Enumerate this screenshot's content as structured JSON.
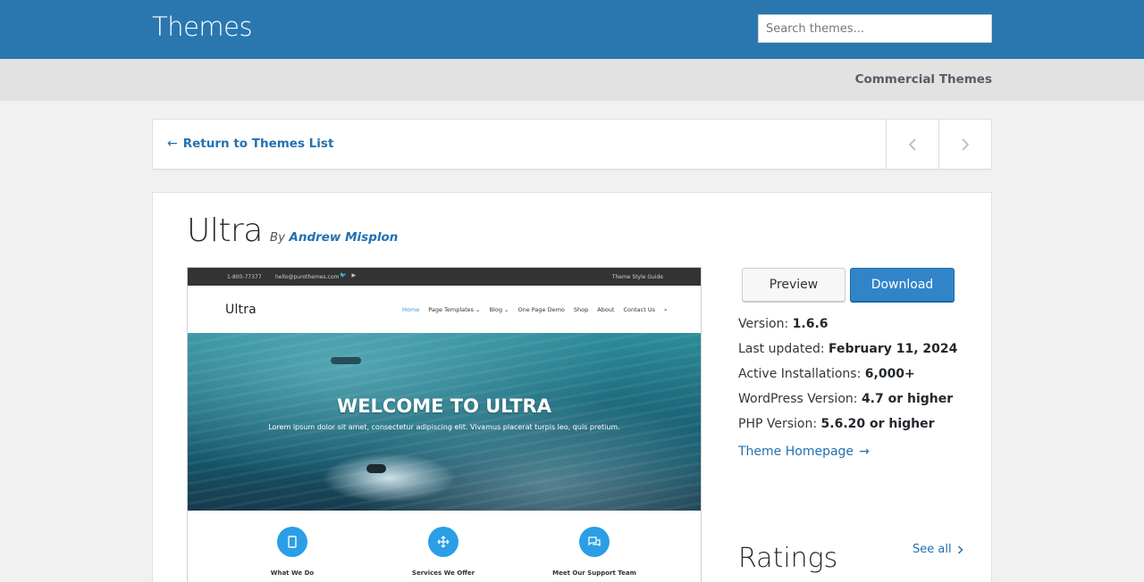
{
  "header": {
    "title": "Themes",
    "search_placeholder": "Search themes..."
  },
  "subnav": {
    "commercial_link": "Commercial Themes"
  },
  "nav": {
    "back_label": "Return to Themes List"
  },
  "theme": {
    "name": "Ultra",
    "by_label": "By",
    "author": "Andrew Misplon"
  },
  "screenshot": {
    "phone": "1-800-77377",
    "email": "hello@purothemes.com",
    "style_guide": "Theme Style Guide",
    "logo": "Ultra",
    "menu": [
      "Home",
      "Page Templates ⌄",
      "Blog ⌄",
      "One Page Demo",
      "Shop",
      "About",
      "Contact Us"
    ],
    "hero_title": "WELCOME TO ULTRA",
    "hero_text": "Lorem ipsum dolor sit amet, consectetur adipiscing elit. Vivamus placerat turpis leo, quis pretium.",
    "features": [
      "What We Do",
      "Services We Offer",
      "Meet Our Support Team"
    ]
  },
  "actions": {
    "preview_label": "Preview",
    "download_label": "Download"
  },
  "meta": {
    "version_label": "Version:",
    "version": "1.6.6",
    "updated_label": "Last updated:",
    "updated": "February 11, 2024",
    "installs_label": "Active Installations:",
    "installs": "6,000+",
    "wp_label": "WordPress Version:",
    "wp": "4.7 or higher",
    "php_label": "PHP Version:",
    "php": "5.6.20 or higher",
    "homepage_label": "Theme Homepage"
  },
  "ratings": {
    "title": "Ratings",
    "see_all": "See all"
  },
  "colors": {
    "header_blue": "#2a77b0",
    "link_blue": "#2271b1",
    "download_blue": "#3284c9",
    "feature_icon_blue": "#2a9fe6"
  }
}
